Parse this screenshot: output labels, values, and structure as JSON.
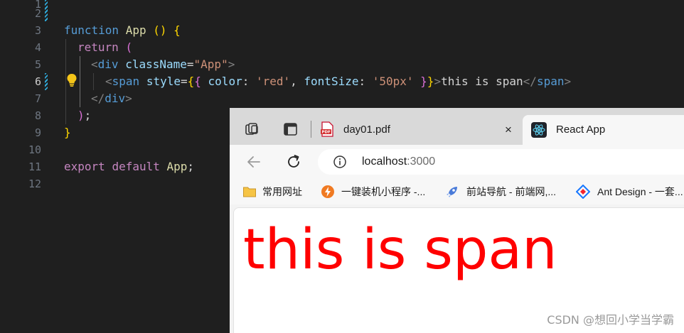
{
  "editor": {
    "line_numbers": [
      "1",
      "2",
      "3",
      "4",
      "5",
      "6",
      "7",
      "8",
      "9",
      "10",
      "11",
      "12"
    ],
    "active_line": "6",
    "code": {
      "l3_kw": "function",
      "l3_name": "App",
      "l3_paren": "()",
      "l3_brace": "{",
      "l4_kw": "return",
      "l4_paren": "(",
      "l5_open": "<",
      "l5_tag": "div",
      "l5_attr": "className",
      "l5_eq": "=",
      "l5_val": "\"App\"",
      "l5_close": ">",
      "l6_open": "<",
      "l6_tag": "span",
      "l6_attr": "style",
      "l6_eq": "=",
      "l6_b1": "{",
      "l6_b2": "{",
      "l6_k1": " color",
      "l6_c1": ": ",
      "l6_v1": "'red'",
      "l6_comma": ", ",
      "l6_k2": "fontSize",
      "l6_c2": ": ",
      "l6_v2": "'50px'",
      "l6_b3": " }",
      "l6_b4": "}",
      "l6_gt": ">",
      "l6_text": "this is span",
      "l6_endopen": "</",
      "l6_endtag": "span",
      "l6_endclose": ">",
      "l7_open": "</",
      "l7_tag": "div",
      "l7_close": ">",
      "l8_paren": ")",
      "l8_semi": ";",
      "l9_brace": "}",
      "l11_kw1": "export",
      "l11_kw2": "default",
      "l11_name": "App",
      "l11_semi": ";"
    }
  },
  "browser": {
    "tabs": [
      {
        "title": "day01.pdf",
        "close": "×"
      },
      {
        "title": "React App"
      }
    ],
    "address": {
      "host": "localhost",
      "port": ":3000"
    },
    "bookmarks": [
      "常用网址",
      "一键装机小程序 -...",
      "前站导航 - 前端网,...",
      "Ant Design - 一套..."
    ],
    "page": {
      "span_text": "this is span",
      "span_color": "#ff0000"
    }
  },
  "watermark": "CSDN @想回小学当学霸"
}
